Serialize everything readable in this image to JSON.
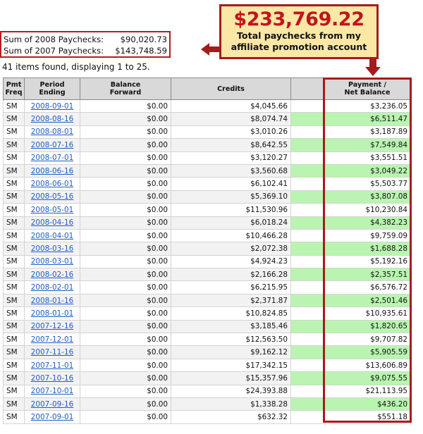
{
  "summary": {
    "sum_2008_label": "Sum of 2008 Paychecks:",
    "sum_2008_value": "$90,020.73",
    "sum_2007_label": "Sum of 2007 Paychecks:",
    "sum_2007_value": "$143,748.59"
  },
  "items_found": "41 items found, displaying 1 to 25.",
  "callout": {
    "amount": "$233,769.22",
    "line1": "Total paychecks from my",
    "line2": "affiliate promotion account"
  },
  "colors": {
    "callout_red": "#c3141c",
    "callout_bg": "#fbe8a6",
    "highlight_border": "#a51c1c",
    "green_column": "#b9f5b0",
    "link_blue": "#1f5cc4"
  },
  "table": {
    "headers": {
      "freq_line1": "Pmt",
      "freq_line2": "Freq",
      "period": "Period Ending",
      "balance_line1": "Balance",
      "balance_line2": "Forward",
      "credits": "Credits",
      "blank": "",
      "payment_line1": "Payment /",
      "payment_line2": "Net Balance"
    },
    "rows": [
      {
        "freq": "SM",
        "period": "2008-09-01",
        "balance": "$0.00",
        "credits": "$4,045.66",
        "payment": "$3,236.05"
      },
      {
        "freq": "SM",
        "period": "2008-08-16",
        "balance": "$0.00",
        "credits": "$8,074.74",
        "payment": "$6,511.47"
      },
      {
        "freq": "SM",
        "period": "2008-08-01",
        "balance": "$0.00",
        "credits": "$3,010.26",
        "payment": "$3,187.89"
      },
      {
        "freq": "SM",
        "period": "2008-07-16",
        "balance": "$0.00",
        "credits": "$8,642.55",
        "payment": "$7,549.84"
      },
      {
        "freq": "SM",
        "period": "2008-07-01",
        "balance": "$0.00",
        "credits": "$3,120.27",
        "payment": "$3,551.51"
      },
      {
        "freq": "SM",
        "period": "2008-06-16",
        "balance": "$0.00",
        "credits": "$3,560.68",
        "payment": "$3,049.22"
      },
      {
        "freq": "SM",
        "period": "2008-06-01",
        "balance": "$0.00",
        "credits": "$6,102.41",
        "payment": "$5,503.77"
      },
      {
        "freq": "SM",
        "period": "2008-05-16",
        "balance": "$0.00",
        "credits": "$5,369.10",
        "payment": "$3,807.08"
      },
      {
        "freq": "SM",
        "period": "2008-05-01",
        "balance": "$0.00",
        "credits": "$11,530.96",
        "payment": "$10,230.84"
      },
      {
        "freq": "SM",
        "period": "2008-04-16",
        "balance": "$0.00",
        "credits": "$6,018.24",
        "payment": "$4,382.23"
      },
      {
        "freq": "SM",
        "period": "2008-04-01",
        "balance": "$0.00",
        "credits": "$10,466.28",
        "payment": "$9,759.09"
      },
      {
        "freq": "SM",
        "period": "2008-03-16",
        "balance": "$0.00",
        "credits": "$2,072.38",
        "payment": "$1,688.28"
      },
      {
        "freq": "SM",
        "period": "2008-03-01",
        "balance": "$0.00",
        "credits": "$4,924.23",
        "payment": "$5,192.16"
      },
      {
        "freq": "SM",
        "period": "2008-02-16",
        "balance": "$0.00",
        "credits": "$2,166.28",
        "payment": "$2,357.51"
      },
      {
        "freq": "SM",
        "period": "2008-02-01",
        "balance": "$0.00",
        "credits": "$6,215.95",
        "payment": "$6,576.72"
      },
      {
        "freq": "SM",
        "period": "2008-01-16",
        "balance": "$0.00",
        "credits": "$2,371.87",
        "payment": "$2,501.46"
      },
      {
        "freq": "SM",
        "period": "2008-01-01",
        "balance": "$0.00",
        "credits": "$10,824.85",
        "payment": "$10,935.61"
      },
      {
        "freq": "SM",
        "period": "2007-12-16",
        "balance": "$0.00",
        "credits": "$3,185.46",
        "payment": "$1,820.65"
      },
      {
        "freq": "SM",
        "period": "2007-12-01",
        "balance": "$0.00",
        "credits": "$12,563.50",
        "payment": "$9,707.82"
      },
      {
        "freq": "SM",
        "period": "2007-11-16",
        "balance": "$0.00",
        "credits": "$9,162.12",
        "payment": "$5,905.59"
      },
      {
        "freq": "SM",
        "period": "2007-11-01",
        "balance": "$0.00",
        "credits": "$17,342.15",
        "payment": "$13,606.89"
      },
      {
        "freq": "SM",
        "period": "2007-10-16",
        "balance": "$0.00",
        "credits": "$15,357.96",
        "payment": "$9,075.55"
      },
      {
        "freq": "SM",
        "period": "2007-10-01",
        "balance": "$0.00",
        "credits": "$24,393.88",
        "payment": "$21,113.95"
      },
      {
        "freq": "SM",
        "period": "2007-09-16",
        "balance": "$0.00",
        "credits": "$1,338.28",
        "payment": "$436.20"
      },
      {
        "freq": "SM",
        "period": "2007-09-01",
        "balance": "$0.00",
        "credits": "$632.32",
        "payment": "$551.18"
      }
    ]
  }
}
